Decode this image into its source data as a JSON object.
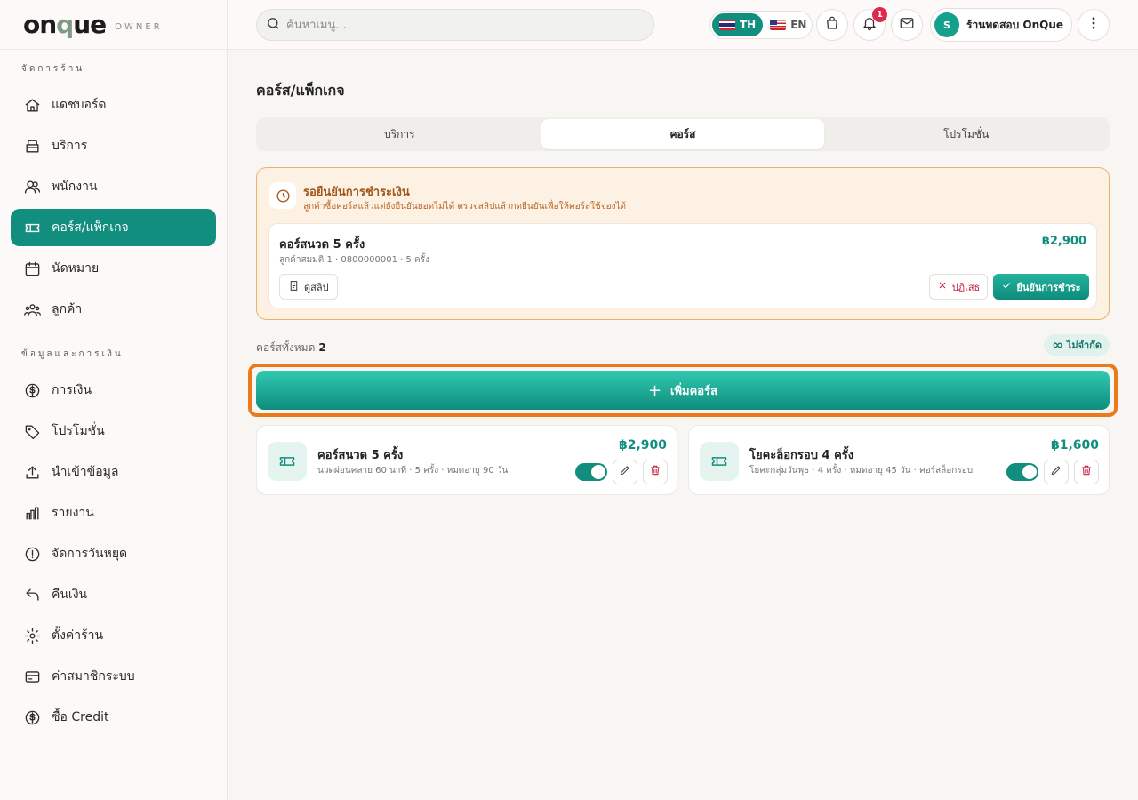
{
  "brand": {
    "logo": "onque",
    "subtitle": "OWNER"
  },
  "sidebar": {
    "sections": [
      {
        "title": "จัดการร้าน"
      },
      {
        "title": "ข้อมูลและการเงิน"
      }
    ],
    "items": [
      {
        "label": "แดชบอร์ด",
        "icon": "home-icon"
      },
      {
        "label": "บริการ",
        "icon": "box-icon"
      },
      {
        "label": "พนักงาน",
        "icon": "users-icon"
      },
      {
        "label": "คอร์ส/แพ็กเกจ",
        "icon": "ticket-icon",
        "active": true
      },
      {
        "label": "นัดหมาย",
        "icon": "calendar-icon"
      },
      {
        "label": "ลูกค้า",
        "icon": "customers-icon"
      },
      {
        "label": "การเงิน",
        "icon": "dollar-circle-icon"
      },
      {
        "label": "โปรโมชั่น",
        "icon": "tag-icon"
      },
      {
        "label": "นำเข้าข้อมูล",
        "icon": "upload-icon"
      },
      {
        "label": "รายงาน",
        "icon": "bar-chart-icon"
      },
      {
        "label": "จัดการวันหยุด",
        "icon": "alert-circle-icon"
      },
      {
        "label": "คืนเงิน",
        "icon": "undo-icon"
      },
      {
        "label": "ตั้งค่าร้าน",
        "icon": "gear-icon"
      },
      {
        "label": "ค่าสมาชิกระบบ",
        "icon": "credit-card-icon"
      },
      {
        "label": "ซื้อ Credit",
        "icon": "dollar-circle-icon"
      }
    ]
  },
  "topbar": {
    "search_placeholder": "ค้นหาเมนู...",
    "lang_th": "TH",
    "lang_en": "EN",
    "notification_count": "1",
    "avatar_initial": "S",
    "shop_name": "ร้านทดสอบ OnQue"
  },
  "page": {
    "title": "คอร์ส/แพ็กเกจ",
    "tabs": [
      {
        "label": "บริการ"
      },
      {
        "label": "คอร์ส",
        "active": true
      },
      {
        "label": "โปรโมชั่น"
      }
    ]
  },
  "pending": {
    "title": "รอยืนยันการชำระเงิน",
    "subtitle": "ลูกค้าซื้อคอร์สแล้วแต่ยังยืนยันยอดไม่ได้ ตรวจสลิปแล้วกดยืนยันเพื่อให้คอร์สใช้จองได้",
    "item": {
      "name": "คอร์สนวด 5 ครั้ง",
      "meta": "ลูกค้าสมมติ 1 · 0800000001 · 5 ครั้ง",
      "price": "฿2,900",
      "view_slip": "ดูสลิป",
      "reject": "ปฏิเสธ",
      "confirm": "ยืนยันการชำระ"
    }
  },
  "courses_summary": {
    "label": "คอร์สทั้งหมด",
    "count": "2",
    "limit_symbol": "∞",
    "limit_label": "ไม่จำกัด"
  },
  "add_button": {
    "label": "เพิ่มคอร์ส"
  },
  "courses": [
    {
      "name": "คอร์สนวด 5 ครั้ง",
      "meta": "นวดผ่อนคลาย 60 นาที · 5 ครั้ง · หมดอายุ 90 วัน",
      "price": "฿2,900",
      "enabled": true
    },
    {
      "name": "โยคะล็อกรอบ 4 ครั้ง",
      "meta": "โยคะกลุ่มวันพุธ · 4 ครั้ง · หมดอายุ 45 วัน · คอร์สล็อกรอบ",
      "price": "฿1,600",
      "enabled": true
    }
  ],
  "colors": {
    "accent": "#128e7e",
    "highlight": "#ec7a1c",
    "pending_bg": "#fdf1e3",
    "danger": "#c2203c"
  }
}
